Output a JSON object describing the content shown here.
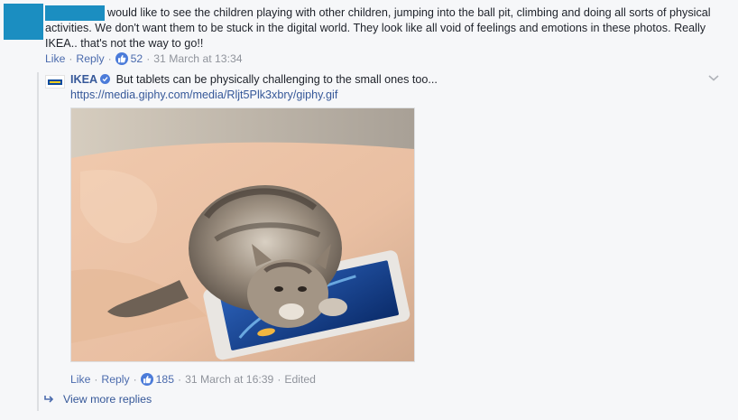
{
  "comment": {
    "text": "would like to see the children playing with other children, jumping into the ball pit, climbing and doing all sorts of physical activities. We don't want them to be stuck in the digital world. They look like all void of feelings and emotions in these photos. Really IKEA.. that's not the way to go!!",
    "actions": {
      "like": "Like",
      "reply": "Reply",
      "like_count": "52",
      "timestamp": "31 March at 13:34"
    }
  },
  "reply": {
    "author": "IKEA",
    "text": "But tablets can be physically challenging to the small ones too...",
    "link": "https://media.giphy.com/media/Rljt5Plk3xbry/giphy.gif",
    "actions": {
      "like": "Like",
      "reply": "Reply",
      "like_count": "185",
      "timestamp": "31 March at 16:39",
      "edited": "Edited"
    }
  },
  "view_more": "View more replies",
  "colors": {
    "accent": "#365899",
    "link": "#4b6bad",
    "meta": "#90949c",
    "redaction": "#1b8ec1",
    "like_badge": "#4b7bd9"
  },
  "icons": [
    "thumbs-up-icon",
    "verified-badge-icon",
    "chevron-down-icon",
    "reply-arrow-icon",
    "ikea-logo"
  ]
}
